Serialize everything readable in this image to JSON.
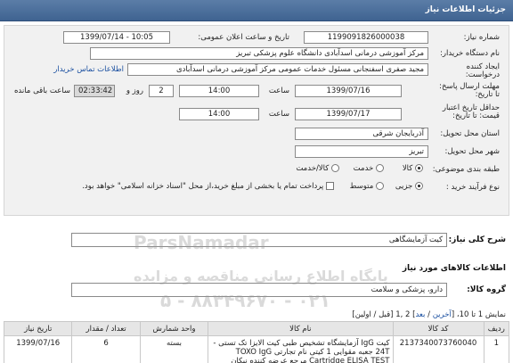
{
  "header": {
    "title": "جزئیات اطلاعات نیاز"
  },
  "form": {
    "need_number_label": "شماره نیاز:",
    "need_number": "1199091826000038",
    "announce_label": "تاریخ و ساعت اعلان عمومی:",
    "announce_value": "1399/07/14 - 10:05",
    "buyer_label": "نام دستگاه خریدار:",
    "buyer_value": "مرکز آموزشی درمانی اسدآبادی دانشگاه علوم پزشکی تبریز",
    "creator_label": "ایجاد کننده درخواست:",
    "creator_value": "مجید  صفری اسفنجانی مسئول خدمات عمومی مرکز آموزشی درمانی اسدآبادی",
    "contact_link": "اطلاعات تماس خریدار",
    "deadline_label": "مهلت ارسال پاسخ: تا تاریخ:",
    "deadline_date": "1399/07/16",
    "time_label": "ساعت",
    "deadline_time": "14:00",
    "days_value": "2",
    "days_label": "روز و",
    "remaining_time": "02:33:42",
    "remaining_label": "ساعت باقی مانده",
    "validity_label": "حداقل تاریخ اعتبار قیمت: تا تاریخ:",
    "validity_date": "1399/07/17",
    "validity_time": "14:00",
    "province_label": "استان محل تحویل:",
    "province_value": "آذربایجان شرقی",
    "city_label": "شهر محل تحویل:",
    "city_value": "تبریز",
    "category_label": "طبقه بندی موضوعی:",
    "category_options": [
      "کالا",
      "خدمت",
      "کالا/خدمت"
    ],
    "process_label": "نوع فرآیند خرید :",
    "process_options": [
      "جزیی",
      "متوسط"
    ],
    "payment_note": "پرداخت تمام یا بخشی از مبلغ خرید،از محل \"اسناد خزانه اسلامی\" خواهد بود."
  },
  "summary": {
    "general_desc_label": "شرح کلی نیاز:",
    "general_desc_value": "کیت آزمایشگاهی",
    "goods_info_title": "اطلاعات کالاهای مورد نیاز",
    "goods_group_label": "گروه کالا:",
    "goods_group_value": "دارو، پزشکی و سلامت"
  },
  "pager": {
    "prefix": "نمایش 1 تا 10، [",
    "last": "آخرین",
    "sep1": " / ",
    "next": "بعد",
    "suffix": "] 2 ,1 [قبل / اولین]"
  },
  "table": {
    "headers": [
      "ردیف",
      "کد کالا",
      "نام کالا",
      "واحد شمارش",
      "تعداد / مقدار",
      "تاریخ نیاز"
    ],
    "rows": [
      {
        "row": "1",
        "code": "2137340073760040",
        "name": "کیت IgG آزمایشگاه تشخیص طبی کیت الایزا تک تستی - 24T جعبه مقوایی 1 کیتی نام تجارتی TOXO IgG Cartridge ELISA TEST مرجع عرضه کننده نیکان",
        "unit": "بسته",
        "qty": "6",
        "date": "1399/07/16"
      }
    ]
  },
  "watermark": {
    "brand": "ParsNamadar",
    "phone": "۰۲۱ - ۸۸۳۴۹۶۷۰ - ۵",
    "tagline": "پایگاه اطلاع رسانی مناقصه و مزایده"
  },
  "colors": {
    "header_bg": "#4a6e9c",
    "link": "#1a4fa0",
    "panel_bg": "#f1f1f1"
  }
}
